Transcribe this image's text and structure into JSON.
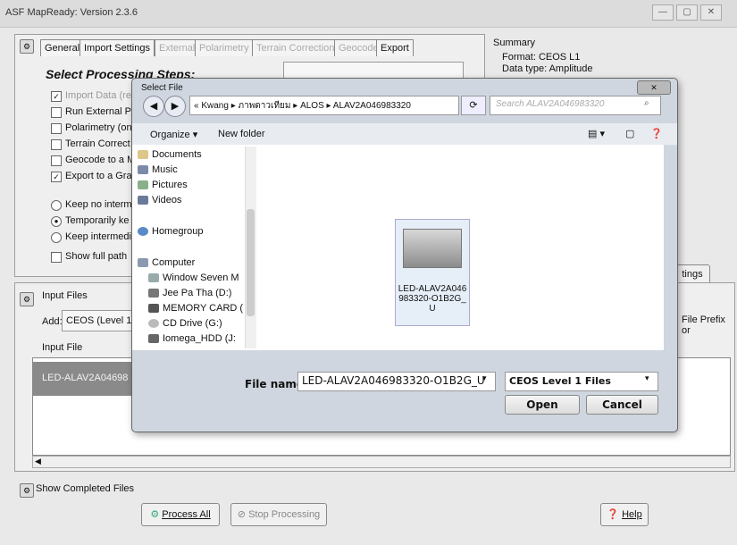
{
  "window": {
    "title": "ASF MapReady: Version 2.3.6"
  },
  "tabs": [
    "General",
    "Import Settings",
    "External",
    "Polarimetry",
    "Terrain Correction",
    "Geocode",
    "Export"
  ],
  "steps": {
    "heading": "Select Processing Steps:",
    "items": [
      {
        "label": "Import Data (re",
        "checked": true,
        "disabled": true
      },
      {
        "label": "Run External P",
        "checked": false
      },
      {
        "label": "Polarimetry (on",
        "checked": false
      },
      {
        "label": "Terrain Correct",
        "checked": false
      },
      {
        "label": "Geocode to a M",
        "checked": false
      },
      {
        "label": "Export to a Gra",
        "checked": true
      }
    ],
    "radios": [
      {
        "label": "Keep no interm",
        "selected": false
      },
      {
        "label": "Temporarily ke",
        "selected": true
      },
      {
        "label": "Keep intermedi",
        "selected": false
      }
    ],
    "show_full_path": "Show full path"
  },
  "summary": {
    "title": "Summary",
    "format": "Format: CEOS L1",
    "data_type": "Data type: Amplitude"
  },
  "settings_button": "tings",
  "input_files": {
    "title": "Input Files",
    "add_label": "Add:",
    "add_value": "CEOS (Level 1",
    "column_header": "Input File",
    "row_value": "LED-ALAV2A04698",
    "file_prefix_label": "File Prefix or"
  },
  "bottom": {
    "show_completed": "Show Completed Files",
    "process_all": "Process All",
    "stop_processing": "Stop Processing",
    "help": "Help"
  },
  "dialog": {
    "title": "Select File",
    "breadcrumb": [
      "«",
      "Kwang",
      "ภาพดาวเทียม",
      "ALOS",
      "ALAV2A046983320"
    ],
    "search_placeholder": "Search ALAV2A046983320",
    "organize": "Organize ▾",
    "new_folder": "New folder",
    "nav_items": [
      "Documents",
      "Music",
      "Pictures",
      "Videos",
      "Homegroup",
      "Computer",
      "Window Seven M",
      "Jee Pa Tha (D:)",
      "MEMORY CARD (",
      "CD Drive (G:)",
      "Iomega_HDD (J:"
    ],
    "file_item": "LED-ALAV2A046983320-O1B2G_U",
    "file_name_label": "File name:",
    "file_name_value": "LED-ALAV2A046983320-O1B2G_U",
    "file_type_value": "CEOS Level 1 Files",
    "open_button": "Open",
    "cancel_button": "Cancel"
  }
}
